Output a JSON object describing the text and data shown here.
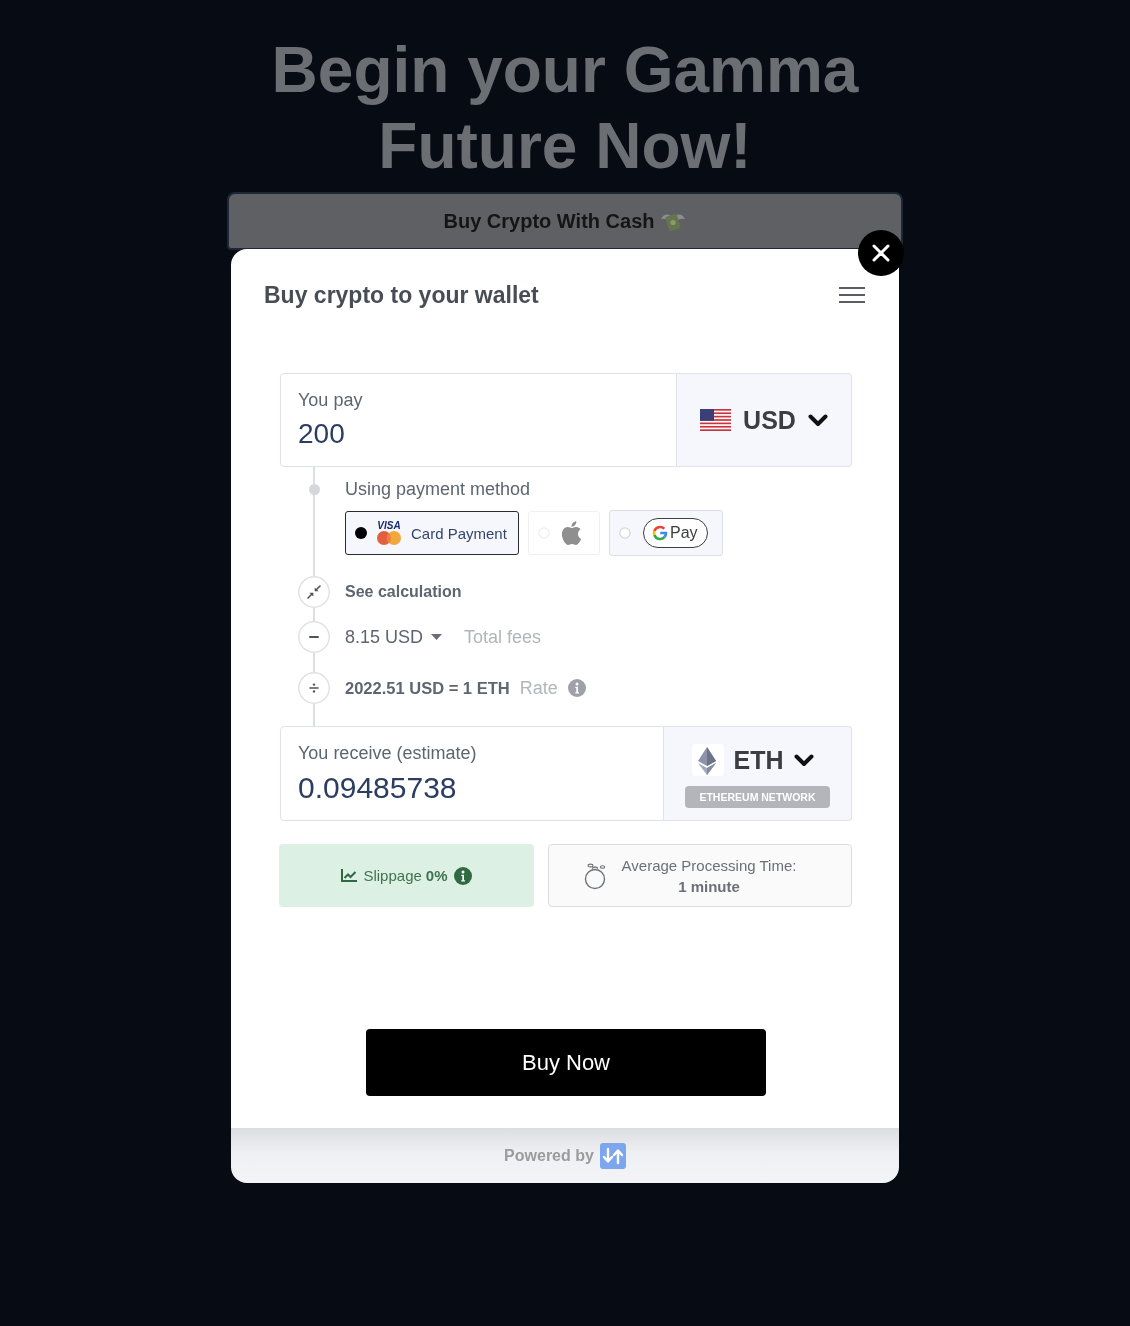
{
  "headline": "Begin your Gamma Future Now!",
  "banner": {
    "label": "Buy Crypto With Cash"
  },
  "widget": {
    "title": "Buy crypto to your wallet",
    "pay": {
      "label": "You pay",
      "value": "200",
      "currency": "USD"
    },
    "payment_methods": {
      "label": "Using payment method",
      "options": [
        {
          "kind": "card",
          "brand": "VISA",
          "label": "Card Payment",
          "selected": true,
          "disabled": false
        },
        {
          "kind": "apple",
          "selected": false,
          "disabled": true
        },
        {
          "kind": "gpay",
          "label": "Pay",
          "selected": false,
          "disabled": false
        }
      ]
    },
    "calculation": {
      "toggle": "See calculation",
      "fees": {
        "value": "8.15 USD",
        "label": "Total fees"
      },
      "rate": {
        "value": "2022.51 USD = 1 ETH",
        "label": "Rate"
      }
    },
    "receive": {
      "label": "You receive (estimate)",
      "value": "0.09485738",
      "currency": "ETH",
      "network": "ETHEREUM NETWORK"
    },
    "slippage": {
      "label": "Slippage",
      "value": "0%"
    },
    "processing": {
      "label": "Average Processing Time:",
      "value": "1 minute"
    },
    "buy_button": "Buy Now"
  },
  "footer": {
    "label": "Powered by"
  }
}
